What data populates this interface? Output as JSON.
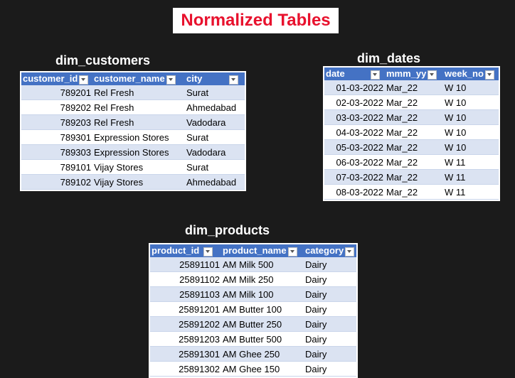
{
  "title": "Normalized Tables",
  "dim_customers": {
    "title": "dim_customers",
    "headers": [
      "customer_id",
      "customer_name",
      "city"
    ],
    "rows": [
      [
        "789201",
        "Rel Fresh",
        "Surat"
      ],
      [
        "789202",
        "Rel Fresh",
        "Ahmedabad"
      ],
      [
        "789203",
        "Rel Fresh",
        "Vadodara"
      ],
      [
        "789301",
        "Expression Stores",
        "Surat"
      ],
      [
        "789303",
        "Expression Stores",
        "Vadodara"
      ],
      [
        "789101",
        "Vijay Stores",
        "Surat"
      ],
      [
        "789102",
        "Vijay Stores",
        "Ahmedabad"
      ]
    ]
  },
  "dim_dates": {
    "title": "dim_dates",
    "headers": [
      "date",
      "mmm_yy",
      "week_no"
    ],
    "rows": [
      [
        "01-03-2022",
        "Mar_22",
        "W 10"
      ],
      [
        "02-03-2022",
        "Mar_22",
        "W 10"
      ],
      [
        "03-03-2022",
        "Mar_22",
        "W 10"
      ],
      [
        "04-03-2022",
        "Mar_22",
        "W 10"
      ],
      [
        "05-03-2022",
        "Mar_22",
        "W 10"
      ],
      [
        "06-03-2022",
        "Mar_22",
        "W 11"
      ],
      [
        "07-03-2022",
        "Mar_22",
        "W 11"
      ],
      [
        "08-03-2022",
        "Mar_22",
        "W 11"
      ]
    ]
  },
  "dim_products": {
    "title": "dim_products",
    "headers": [
      "product_id",
      "product_name",
      "category"
    ],
    "rows": [
      [
        "25891101",
        "AM Milk 500",
        "Dairy"
      ],
      [
        "25891102",
        "AM Milk 250",
        "Dairy"
      ],
      [
        "25891103",
        "AM Milk 100",
        "Dairy"
      ],
      [
        "25891201",
        "AM Butter 100",
        "Dairy"
      ],
      [
        "25891202",
        "AM Butter 250",
        "Dairy"
      ],
      [
        "25891203",
        "AM Butter 500",
        "Dairy"
      ],
      [
        "25891301",
        "AM Ghee 250",
        "Dairy"
      ],
      [
        "25891302",
        "AM Ghee 150",
        "Dairy"
      ]
    ]
  },
  "colors": {
    "header_bg": "#4472c4",
    "band_row": "#dbe3f2",
    "title_text": "#e8112d",
    "background": "#1b1b1b"
  },
  "icons": {
    "filter": "filter-dropdown-icon"
  }
}
